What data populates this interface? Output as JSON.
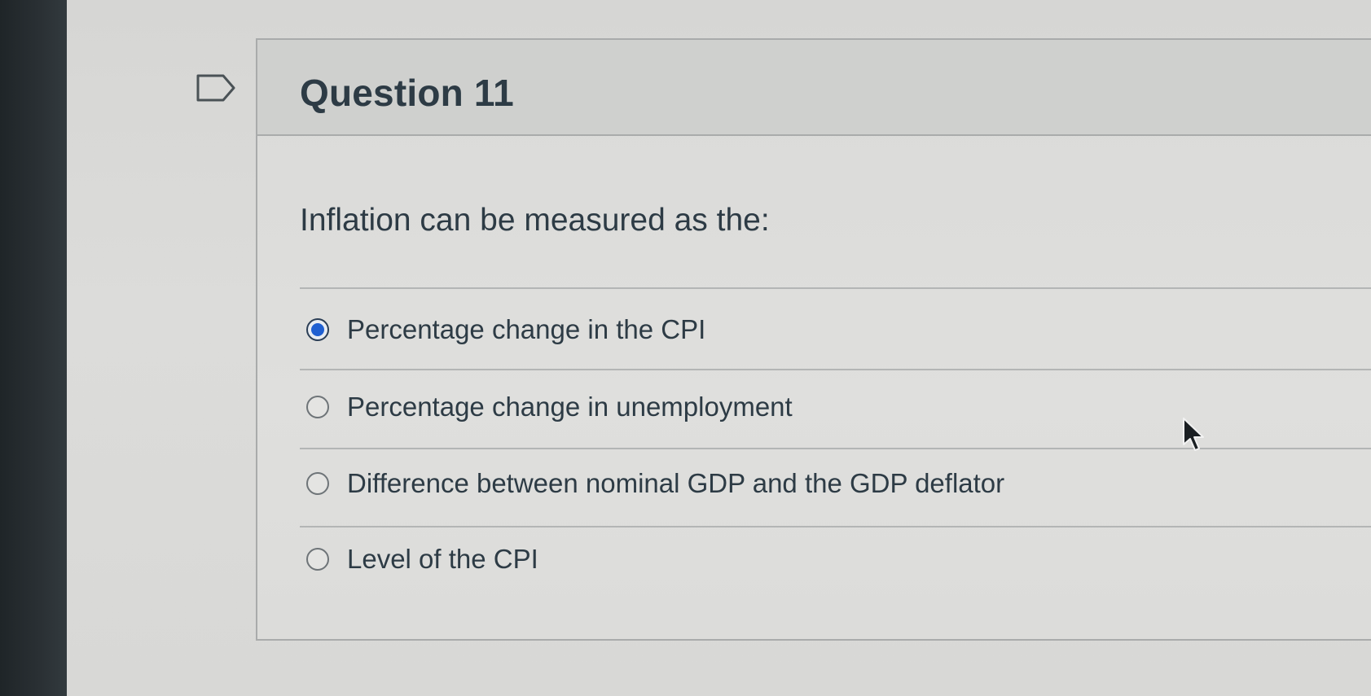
{
  "question": {
    "title": "Question 11",
    "text": "Inflation can be measured as the:",
    "answers": [
      {
        "label": "Percentage change in the CPI",
        "selected": true
      },
      {
        "label": "Percentage change in unemployment",
        "selected": false
      },
      {
        "label": "Difference between nominal GDP and the GDP deflator",
        "selected": false
      },
      {
        "label": "Level of the CPI",
        "selected": false
      }
    ]
  },
  "icons": {
    "flag": "flag-icon",
    "cursor": "mouse-pointer-icon"
  },
  "colors": {
    "selected_radio": "#1f5fd1",
    "text": "#2d3b45"
  }
}
